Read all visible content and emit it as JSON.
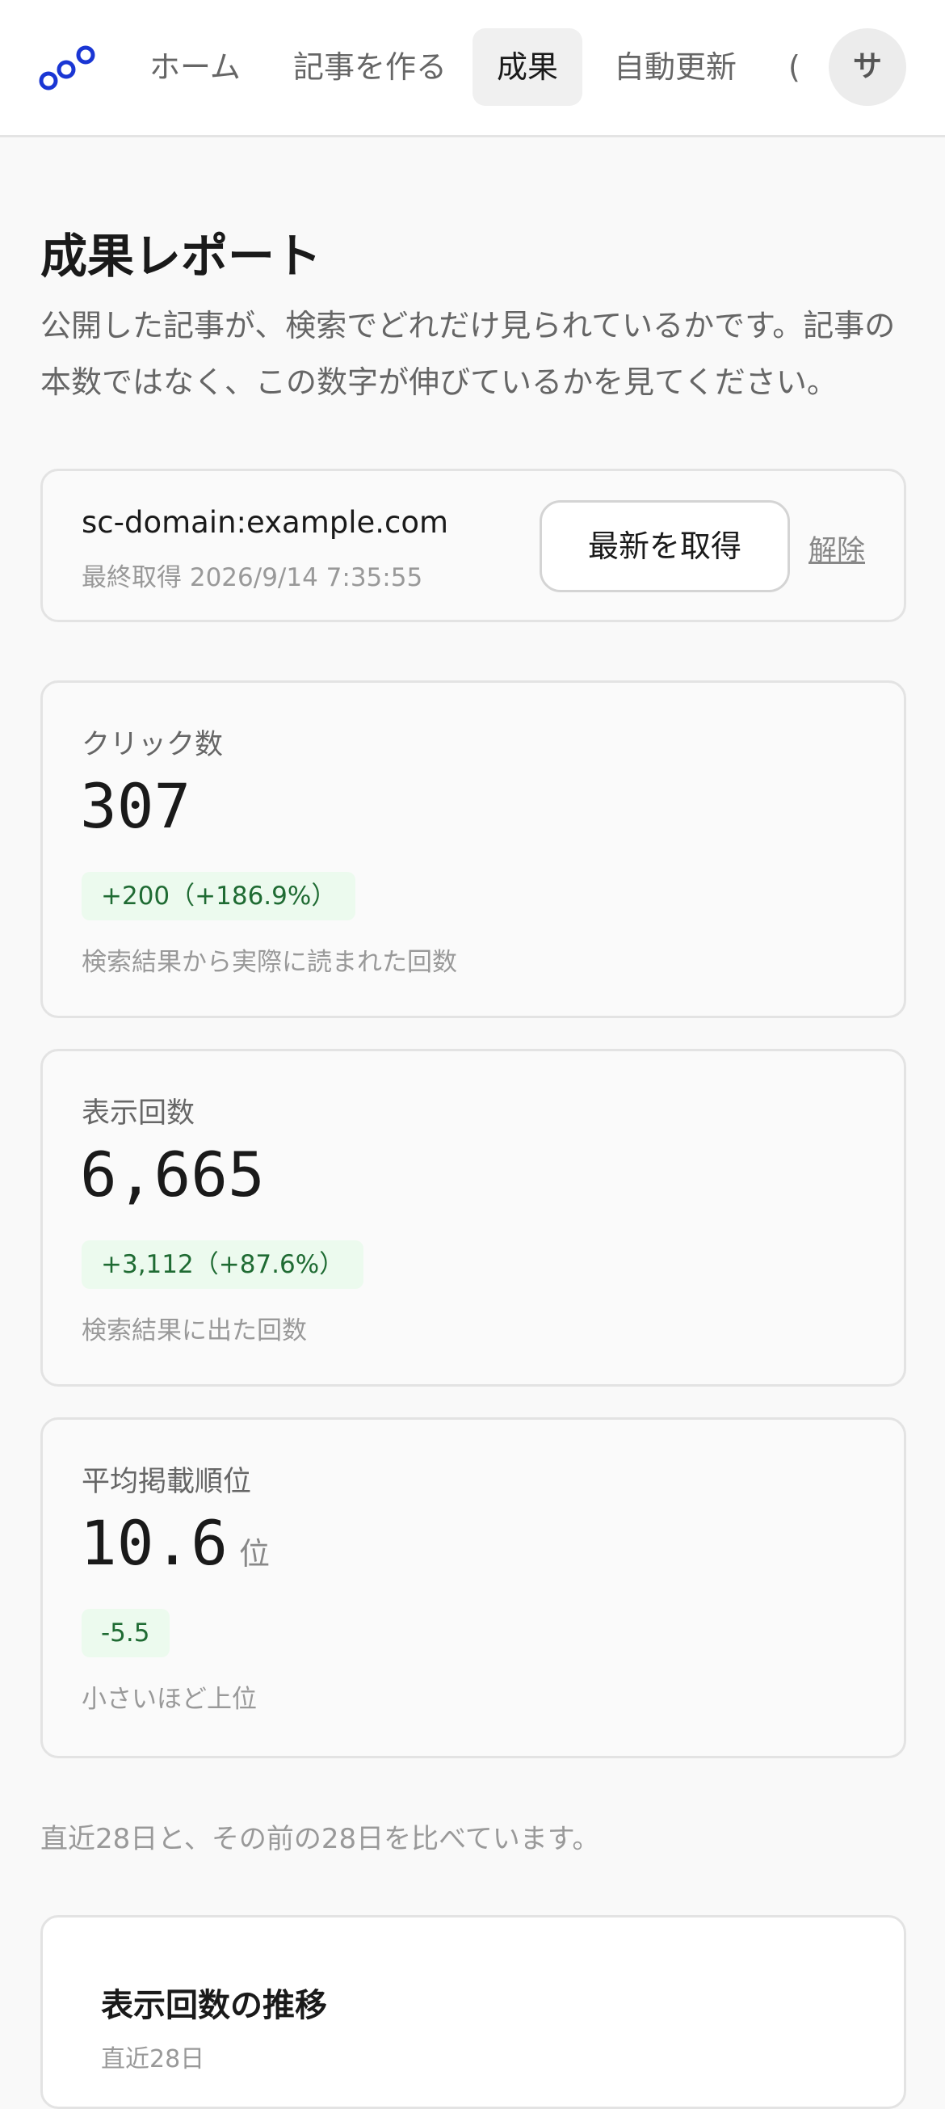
{
  "header": {
    "logo_icon": "three-circles-logo-icon",
    "accent_color": "#1a36d4",
    "nav": [
      {
        "label": "ホーム",
        "active": false
      },
      {
        "label": "記事を作る",
        "active": false
      },
      {
        "label": "成果",
        "active": true
      },
      {
        "label": "自動更新",
        "active": false
      }
    ],
    "nav_clipped_label": "(",
    "avatar_initial": "サ"
  },
  "page": {
    "title": "成果レポート",
    "description": "公開した記事が、検索でどれだけ見られているかです。記事の本数ではなく、この数字が伸びているかを見てください。"
  },
  "property": {
    "domain": "sc-domain:example.com",
    "last_fetched": "最終取得 2026/9/14 7:35:55",
    "fetch_label": "最新を取得",
    "unlink_label": "解除"
  },
  "metrics": [
    {
      "label": "クリック数",
      "value": "307",
      "unit": "",
      "delta": "+200（+186.9%）",
      "note": "検索結果から実際に読まれた回数"
    },
    {
      "label": "表示回数",
      "value": "6,665",
      "unit": "",
      "delta": "+3,112（+87.6%）",
      "note": "検索結果に出た回数"
    },
    {
      "label": "平均掲載順位",
      "value": "10.6",
      "unit": "位",
      "delta": "-5.5",
      "note": "小さいほど上位"
    }
  ],
  "compare_note": "直近28日と、その前の28日を比べています。",
  "chart_card": {
    "title": "表示回数の推移",
    "subtitle": "直近28日"
  },
  "colors": {
    "positive_bg": "#ecfaee",
    "positive_text": "#1f6b33"
  }
}
